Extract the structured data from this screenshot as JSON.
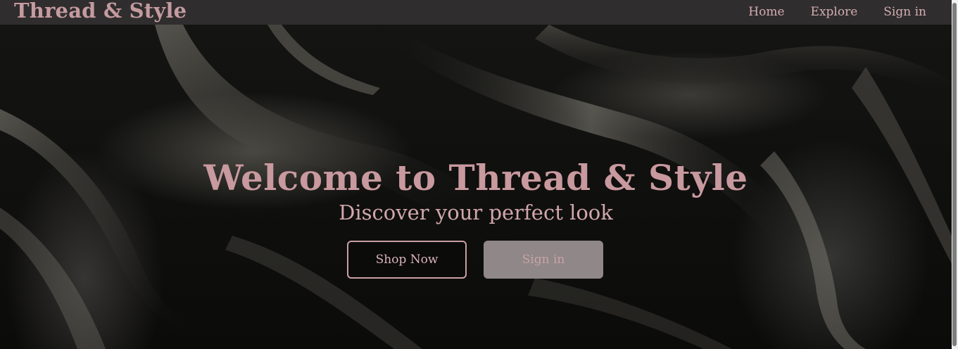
{
  "navbar": {
    "brand": "Thread & Style",
    "links": [
      {
        "label": "Home"
      },
      {
        "label": "Explore"
      },
      {
        "label": "Sign in"
      }
    ]
  },
  "hero": {
    "title": "Welcome to Thread & Style",
    "subtitle": "Discover your perfect look",
    "primary_button": "Shop Now",
    "secondary_button": "Sign in"
  },
  "colors": {
    "navbar_bg": "#302d2e",
    "accent_pink": "#c8999e",
    "secondary_button_bg": "#8f8788"
  }
}
